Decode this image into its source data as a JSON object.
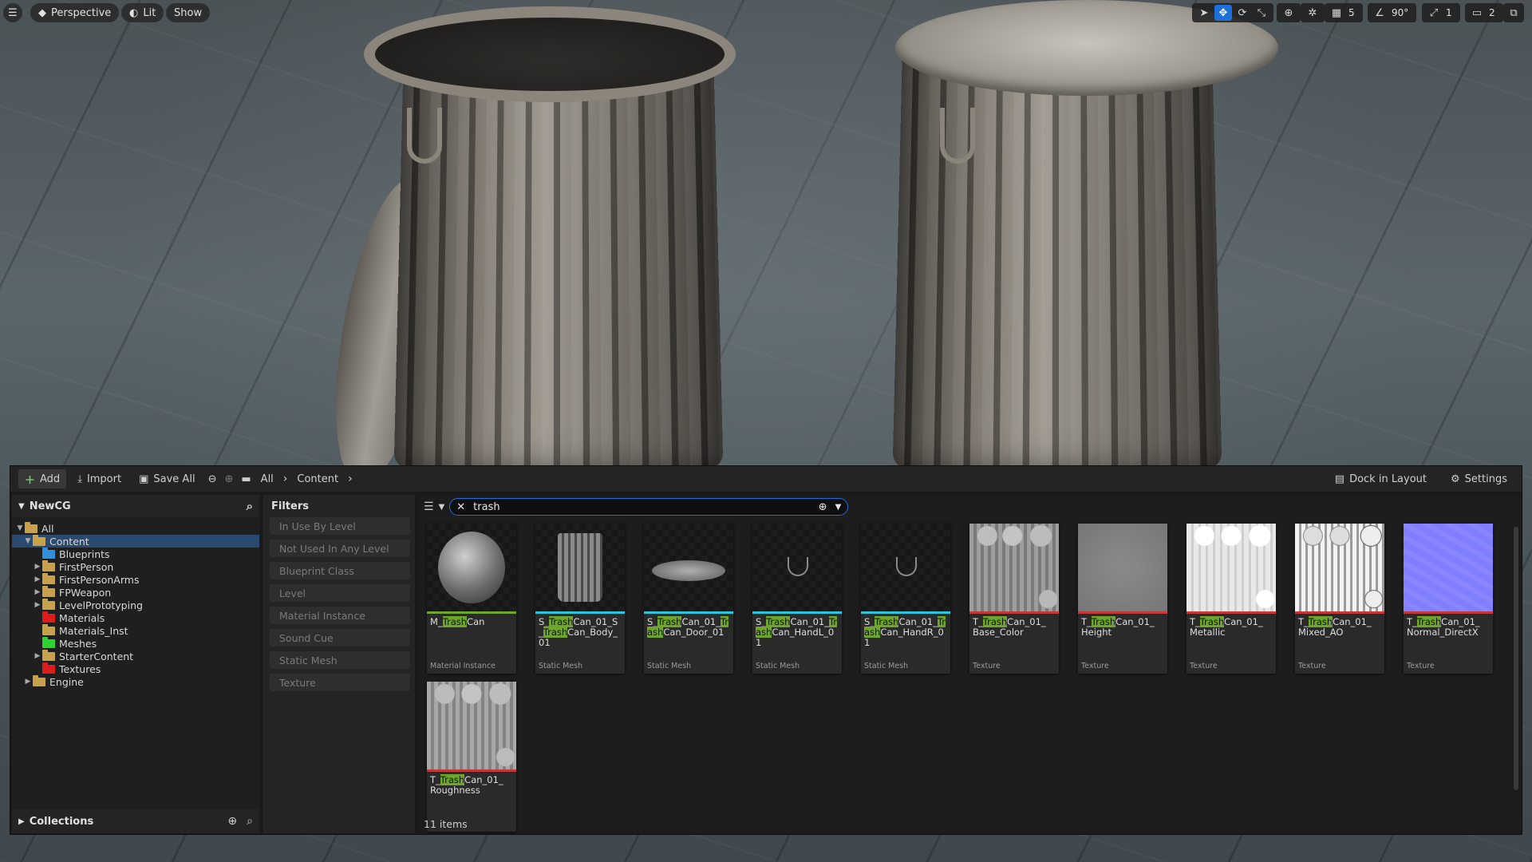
{
  "viewport": {
    "perspective_label": "Perspective",
    "lit_label": "Lit",
    "show_label": "Show",
    "grid_snap_value": "5",
    "rotation_snap_value": "90°",
    "scale_snap_value": "1",
    "camera_speed_value": "2"
  },
  "toolbar": {
    "add_label": "Add",
    "import_label": "Import",
    "save_all_label": "Save All",
    "breadcrumbs": [
      "All",
      "Content"
    ],
    "dock_label": "Dock in Layout",
    "settings_label": "Settings"
  },
  "tree": {
    "root_label": "NewCG",
    "collections_label": "Collections",
    "items": [
      {
        "label": "All",
        "color": "#c8a24a"
      },
      {
        "label": "Content",
        "color": "#c8a24a"
      },
      {
        "label": "Blueprints",
        "color": "#2f8fdd"
      },
      {
        "label": "FirstPerson",
        "color": "#c8a24a"
      },
      {
        "label": "FirstPersonArms",
        "color": "#c8a24a"
      },
      {
        "label": "FPWeapon",
        "color": "#c8a24a"
      },
      {
        "label": "LevelPrototyping",
        "color": "#c8a24a"
      },
      {
        "label": "Materials",
        "color": "#e01b1b"
      },
      {
        "label": "Materials_Inst",
        "color": "#c8a24a"
      },
      {
        "label": "Meshes",
        "color": "#2fd32f"
      },
      {
        "label": "StarterContent",
        "color": "#c8a24a"
      },
      {
        "label": "Textures",
        "color": "#e01b1b"
      },
      {
        "label": "Engine",
        "color": "#c8a24a"
      }
    ]
  },
  "filters": {
    "title": "Filters",
    "items": [
      "In Use By Level",
      "Not Used In Any Level",
      "Blueprint Class",
      "Level",
      "Material Instance",
      "Sound Cue",
      "Static Mesh",
      "Texture"
    ]
  },
  "search": {
    "value": "trash",
    "highlight": "Trash"
  },
  "assets": [
    {
      "pre": "M_",
      "hl": "Trash",
      "post": "Can",
      "pre2": "",
      "hl2": "",
      "post2": "",
      "type": "Material Instance",
      "line": "#6ea52c"
    },
    {
      "pre": "S_",
      "hl": "Trash",
      "post": "Can_01_S_",
      "pre2": "",
      "hl2": "Trash",
      "post2": "Can_Body_01",
      "type": "Static Mesh",
      "line": "#2bc6d6"
    },
    {
      "pre": "S_",
      "hl": "Trash",
      "post": "Can_01_",
      "pre2": "",
      "hl2": "Trash",
      "post2": "Can_Door_01",
      "type": "Static Mesh",
      "line": "#2bc6d6"
    },
    {
      "pre": "S_",
      "hl": "Trash",
      "post": "Can_01_",
      "pre2": "",
      "hl2": "Trash",
      "post2": "Can_HandL_01",
      "type": "Static Mesh",
      "line": "#2bc6d6"
    },
    {
      "pre": "S_",
      "hl": "Trash",
      "post": "Can_01_",
      "pre2": "",
      "hl2": "Trash",
      "post2": "Can_HandR_01",
      "type": "Static Mesh",
      "line": "#2bc6d6"
    },
    {
      "pre": "T_",
      "hl": "Trash",
      "post": "Can_01_",
      "pre2": "Base_Color",
      "hl2": "",
      "post2": "",
      "type": "Texture",
      "line": "#c2393a"
    },
    {
      "pre": "T_",
      "hl": "Trash",
      "post": "Can_01_",
      "pre2": "Height",
      "hl2": "",
      "post2": "",
      "type": "Texture",
      "line": "#c2393a"
    },
    {
      "pre": "T_",
      "hl": "Trash",
      "post": "Can_01_",
      "pre2": "Metallic",
      "hl2": "",
      "post2": "",
      "type": "Texture",
      "line": "#c2393a"
    },
    {
      "pre": "T_",
      "hl": "Trash",
      "post": "Can_01_",
      "pre2": "Mixed_AO",
      "hl2": "",
      "post2": "",
      "type": "Texture",
      "line": "#c2393a"
    },
    {
      "pre": "T_",
      "hl": "Trash",
      "post": "Can_01_",
      "pre2": "Normal_DirectX",
      "hl2": "",
      "post2": "",
      "type": "Texture",
      "line": "#c2393a"
    },
    {
      "pre": "T_",
      "hl": "Trash",
      "post": "Can_01_",
      "pre2": "Roughness",
      "hl2": "",
      "post2": "",
      "type": "",
      "line": "#c2393a"
    }
  ],
  "status": {
    "items_count": "11 items"
  }
}
